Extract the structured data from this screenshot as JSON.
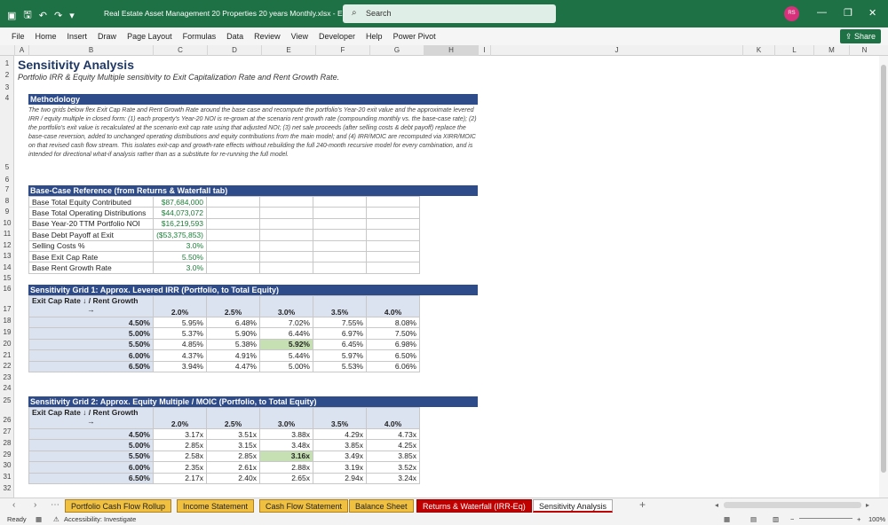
{
  "window": {
    "title": "Real Estate Asset Management 20 Properties  20 years Monthly.xlsx  -  E...",
    "search_placeholder": "Search",
    "user_initials": "RS",
    "share_label": "Share"
  },
  "menu": [
    "File",
    "Home",
    "Insert",
    "Draw",
    "Page Layout",
    "Formulas",
    "Data",
    "Review",
    "View",
    "Developer",
    "Help",
    "Power Pivot"
  ],
  "columns": [
    "A",
    "B",
    "C",
    "D",
    "E",
    "F",
    "G",
    "H",
    "I",
    "J",
    "K",
    "L",
    "M",
    "N"
  ],
  "rows": [
    "1",
    "2",
    "3",
    "4",
    "5",
    "6",
    "7",
    "8",
    "9",
    "10",
    "11",
    "12",
    "13",
    "14",
    "15",
    "16",
    "17",
    "18",
    "19",
    "20",
    "21",
    "22",
    "23",
    "24",
    "25",
    "26",
    "27",
    "28",
    "29",
    "30",
    "31",
    "32"
  ],
  "sheet": {
    "title": "Sensitivity Analysis",
    "subtitle": "Portfolio IRR & Equity Multiple sensitivity to Exit Capitalization Rate and Rent Growth Rate.",
    "methodology_header": "Methodology",
    "methodology_text": "The two grids below flex Exit Cap Rate and Rent Growth Rate around the base case and recompute the portfolio's Year-20 exit value and the approximate levered IRR / equity multiple in closed form: (1) each property's Year-20 NOI is re-grown at the scenario rent growth rate (compounding monthly vs. the base-case rate); (2) the portfolio's exit value is recalculated at the scenario exit cap rate using that adjusted NOI; (3) net sale proceeds (after selling costs & debt payoff) replace the base-case reversion, added to unchanged operating distributions and equity contributions from the main model; and (4) IRR/MOIC are recomputed via XIRR/MOIC on that revised cash flow stream. This isolates exit-cap and growth-rate effects without rebuilding the full 240-month recursive model for every combination, and is intended for directional what-if analysis rather than as a substitute for re-running the full model.",
    "base_header": "Base-Case Reference (from Returns & Waterfall tab)",
    "base_rows": [
      {
        "label": "Base Total Equity Contributed",
        "value": "$87,684,000"
      },
      {
        "label": "Base Total Operating Distributions",
        "value": "$44,073,072"
      },
      {
        "label": "Base Year-20 TTM Portfolio NOI",
        "value": "$16,219,593"
      },
      {
        "label": "Base Debt Payoff at Exit",
        "value": "($53,375,853)"
      },
      {
        "label": "Selling Costs %",
        "value": "3.0%"
      },
      {
        "label": "Base Exit Cap Rate",
        "value": "5.50%"
      },
      {
        "label": "Base Rent Growth Rate",
        "value": "3.0%"
      }
    ],
    "grid1": {
      "header": "Sensitivity Grid 1: Approx. Levered IRR (Portfolio, to Total Equity)",
      "corner_line1": "Exit Cap Rate ↓  /  Rent Growth",
      "corner_line2": "→",
      "cols": [
        "2.0%",
        "2.5%",
        "3.0%",
        "3.5%",
        "4.0%"
      ],
      "rows": [
        {
          "cap": "4.50%",
          "vals": [
            "5.95%",
            "6.48%",
            "7.02%",
            "7.55%",
            "8.08%"
          ]
        },
        {
          "cap": "5.00%",
          "vals": [
            "5.37%",
            "5.90%",
            "6.44%",
            "6.97%",
            "7.50%"
          ]
        },
        {
          "cap": "5.50%",
          "vals": [
            "4.85%",
            "5.38%",
            "5.92%",
            "6.45%",
            "6.98%"
          ]
        },
        {
          "cap": "6.00%",
          "vals": [
            "4.37%",
            "4.91%",
            "5.44%",
            "5.97%",
            "6.50%"
          ]
        },
        {
          "cap": "6.50%",
          "vals": [
            "3.94%",
            "4.47%",
            "5.00%",
            "5.53%",
            "6.06%"
          ]
        }
      ]
    },
    "grid2": {
      "header": "Sensitivity Grid 2: Approx. Equity Multiple / MOIC (Portfolio, to Total Equity)",
      "corner_line1": "Exit Cap Rate ↓  /  Rent Growth",
      "corner_line2": "→",
      "cols": [
        "2.0%",
        "2.5%",
        "3.0%",
        "3.5%",
        "4.0%"
      ],
      "rows": [
        {
          "cap": "4.50%",
          "vals": [
            "3.17x",
            "3.51x",
            "3.88x",
            "4.29x",
            "4.73x"
          ]
        },
        {
          "cap": "5.00%",
          "vals": [
            "2.85x",
            "3.15x",
            "3.48x",
            "3.85x",
            "4.25x"
          ]
        },
        {
          "cap": "5.50%",
          "vals": [
            "2.58x",
            "2.85x",
            "3.16x",
            "3.49x",
            "3.85x"
          ]
        },
        {
          "cap": "6.00%",
          "vals": [
            "2.35x",
            "2.61x",
            "2.88x",
            "3.19x",
            "3.52x"
          ]
        },
        {
          "cap": "6.50%",
          "vals": [
            "2.17x",
            "2.40x",
            "2.65x",
            "2.94x",
            "3.24x"
          ]
        }
      ]
    }
  },
  "tabs": [
    "Portfolio Cash Flow Rollup",
    "Income Statement",
    "Cash Flow Statement",
    "Balance Sheet",
    "Returns & Waterfall (IRR-Eq)",
    "Sensitivity Analysis"
  ],
  "status": {
    "ready": "Ready",
    "accessibility": "Accessibility: Investigate",
    "zoom": "100%"
  }
}
